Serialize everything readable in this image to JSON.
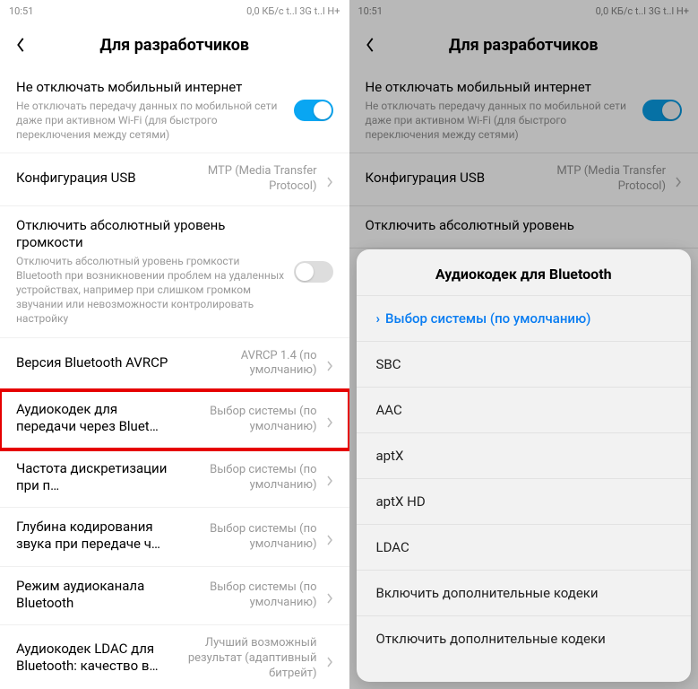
{
  "status": {
    "time": "10:51",
    "net": "0,0 КБ/с  t..l  3G t..l  H+"
  },
  "header": {
    "title": "Для разработчиков"
  },
  "rows": {
    "keep_mobile": {
      "title": "Не отключать мобильный интернет",
      "desc": "Не отключать передачу данных по мобильной сети даже при активном Wi-Fi (для быстрого переключения между сетями)"
    },
    "usb": {
      "title": "Конфигурация USB",
      "value": "MTP (Media Transfer Protocol)"
    },
    "abs_volume": {
      "title": "Отключить абсолютный уровень громкости",
      "desc": "Отключить абсолютный уровень громкости Bluetooth при возникновении проблем на удаленных устройствах, например при слишком громком звучании или невозможности контролировать настройку"
    },
    "avrcp": {
      "title": "Версия Bluetooth AVRCP",
      "value": "AVRCP 1.4 (по умолчанию)"
    },
    "codec": {
      "title": "Аудиокодек для передачи через Bluet…",
      "value": "Выбор системы (по умолчанию)"
    },
    "freq": {
      "title": "Частота дискретизации при п…",
      "value": "Выбор системы (по умолчанию)"
    },
    "depth": {
      "title": "Глубина кодирования звука при передаче ч…",
      "value": "Выбор системы (по умолчанию)"
    },
    "channel": {
      "title": "Режим аудиоканала Bluetooth",
      "value": "Выбор системы (по умолчанию)"
    },
    "ldac": {
      "title": "Аудиокодек LDAC для Bluetooth: качество в…",
      "value": "Лучший возможный результат (адаптивный битрейт)"
    },
    "abs_volume_short": {
      "title": "Отключить абсолютный уровень"
    }
  },
  "sheet": {
    "title": "Аудиокодек для Bluetooth",
    "options": {
      "default": "Выбор системы (по умолчанию)",
      "sbc": "SBC",
      "aac": "AAC",
      "aptx": "aptX",
      "aptxhd": "aptX HD",
      "ldac": "LDAC",
      "enable": "Включить дополнительные кодеки",
      "disable": "Отключить дополнительные кодеки"
    }
  }
}
